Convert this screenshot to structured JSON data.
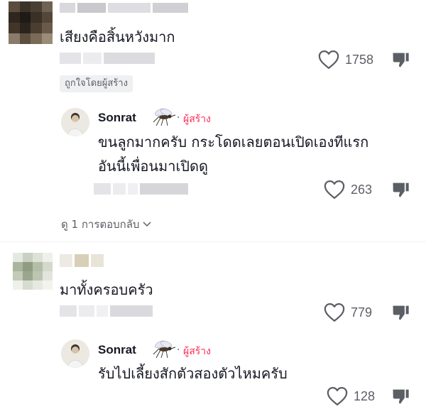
{
  "comment1": {
    "text": "เสียงคือสิ้นหวังมาก",
    "likes": "1758",
    "liked_by_creator_badge": "ถูกใจโดยผู้สร้าง"
  },
  "reply1": {
    "author": "Sonrat",
    "creator_tag": "ผู้สร้าง",
    "separator": "·",
    "line1": "ขนลูกมากครับ กระโดดเลยตอนเปิดเองทีแรก",
    "line2": "อันนี้เพื่อนมาเปิดดู",
    "likes": "263"
  },
  "view_replies": {
    "label": "ดู 1 การตอบกลับ",
    "icon": "chevron-down-icon"
  },
  "comment2": {
    "text": "มาทั้งครอบครัว",
    "likes": "779"
  },
  "reply2": {
    "author": "Sonrat",
    "creator_tag": "ผู้สร้าง",
    "separator": "·",
    "text": "รับไปเลี้ยงสักตัวสองตัวไหมครับ",
    "likes": "128"
  },
  "colors": {
    "creator_red": "#fe2c55",
    "text": "#161823",
    "secondary": "#5c5e66"
  }
}
